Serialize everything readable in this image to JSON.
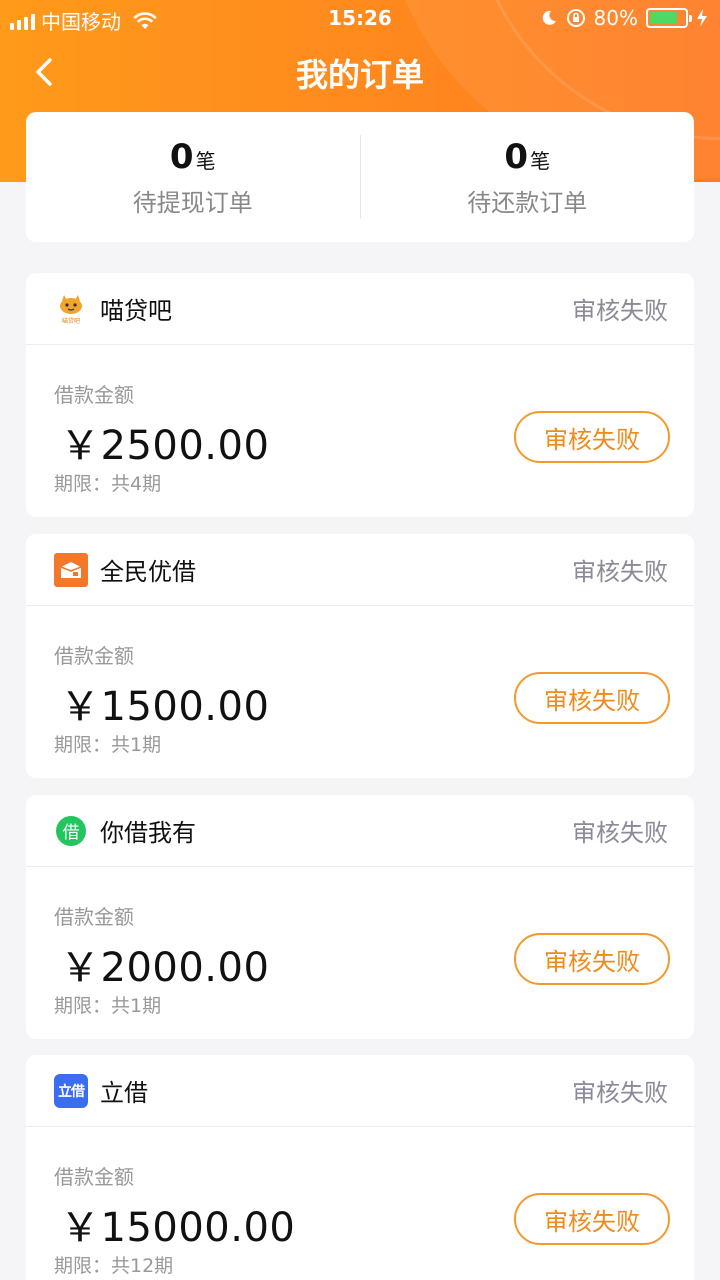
{
  "status_bar": {
    "carrier": "中国移动",
    "time": "15:26",
    "battery": "80%",
    "battery_level": 0.8
  },
  "nav": {
    "title": "我的订单"
  },
  "summary": {
    "unit": "笔",
    "items": [
      {
        "count": "0",
        "label": "待提现订单"
      },
      {
        "count": "0",
        "label": "待还款订单"
      }
    ]
  },
  "labels": {
    "amount": "借款金额"
  },
  "orders": [
    {
      "name": "喵贷吧",
      "logo_icon": "cat-logo-icon",
      "logo_text": "喵贷吧",
      "status": "审核失败",
      "amount": "￥2500.00",
      "term": "期限：共4期",
      "button": "审核失败"
    },
    {
      "name": "全民优借",
      "logo_icon": "box-logo-icon",
      "status": "审核失败",
      "amount": "￥1500.00",
      "term": "期限：共1期",
      "button": "审核失败"
    },
    {
      "name": "你借我有",
      "logo_icon": "jie-green-logo-icon",
      "logo_text": "借",
      "status": "审核失败",
      "amount": "￥2000.00",
      "term": "期限：共1期",
      "button": "审核失败"
    },
    {
      "name": "立借",
      "logo_icon": "lijie-blue-logo-icon",
      "logo_text": "立借",
      "status": "审核失败",
      "amount": "￥15000.00",
      "term": "期限：共12期",
      "button": "审核失败"
    }
  ],
  "colors": {
    "header_orange": "#ff8a1e",
    "accent": "#f08a1a",
    "status_gray": "#8a8a99",
    "background": "#f5f5f7"
  }
}
